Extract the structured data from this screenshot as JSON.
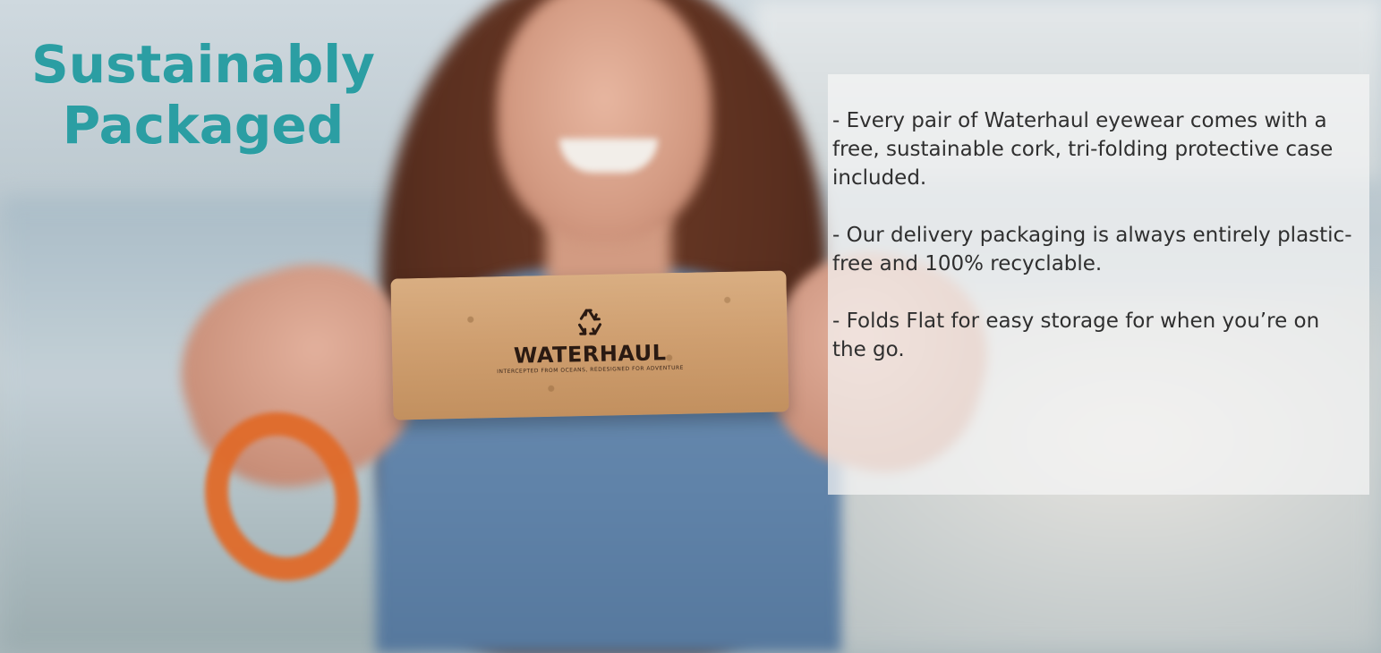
{
  "headline": {
    "line1": "Sustainably",
    "line2": "Packaged"
  },
  "panel": {
    "bullets": [
      "- Every pair of Waterhaul eyewear comes with a free, sustainable cork, tri-folding protective case included.",
      "- Our delivery packaging is always entirely plastic-free and 100% recyclable.",
      "- Folds Flat for easy storage for when you’re on the go."
    ]
  },
  "product": {
    "brand": "WATERHAUL",
    "tagline": "INTERCEPTED FROM OCEANS, REDESIGNED FOR ADVENTURE",
    "icon": "recycle-icon"
  },
  "colors": {
    "headline": "#2b9ea3",
    "panel_bg": "rgba(245,245,245,0.72)",
    "panel_text": "#2f2f2f",
    "bracelet": "#e06b2a"
  }
}
